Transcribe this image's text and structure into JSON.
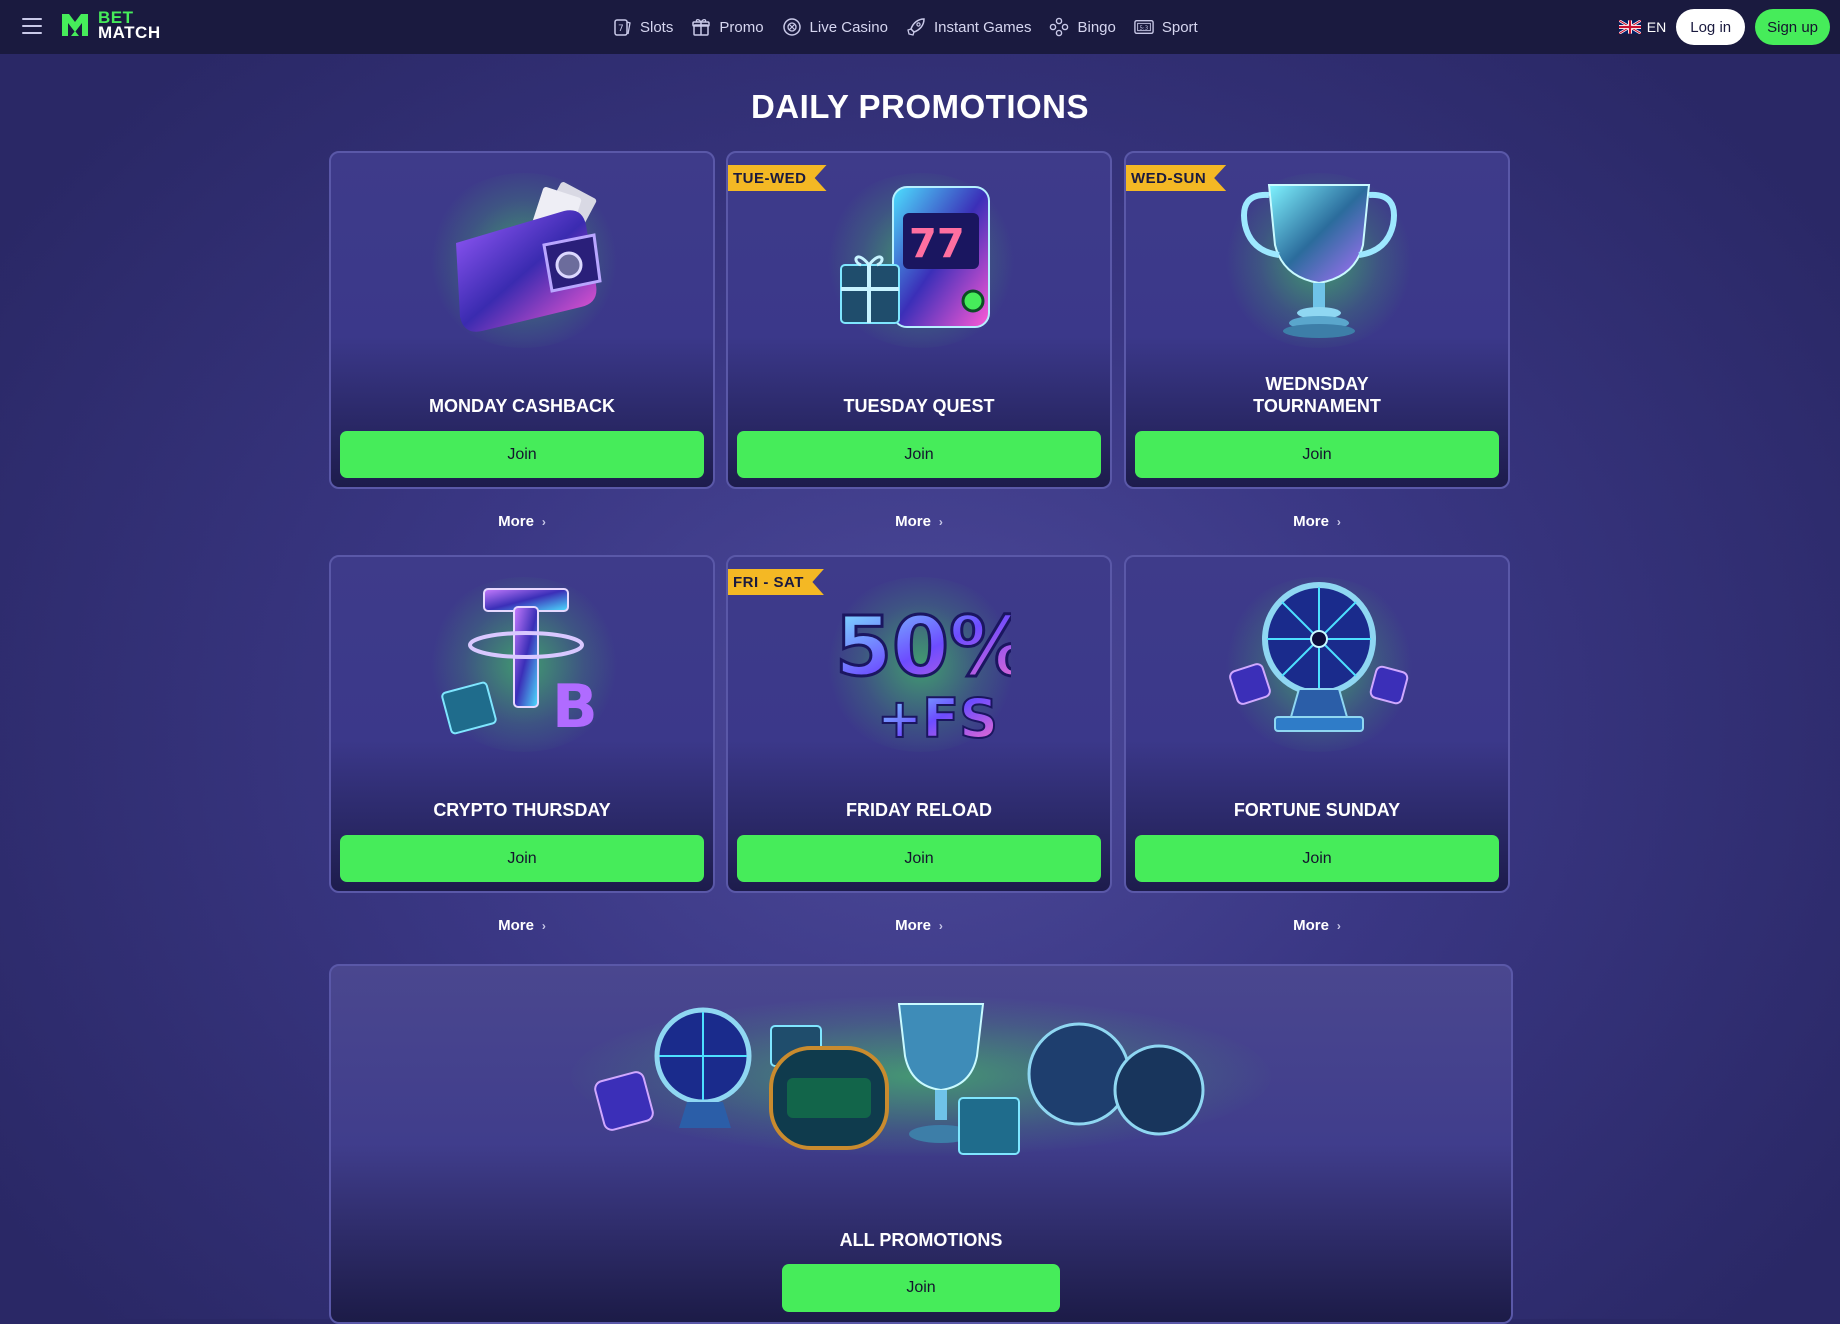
{
  "header": {
    "logo_top": "BET",
    "logo_bottom": "MATCH",
    "nav": [
      {
        "label": "Slots",
        "icon": "slot-card-icon"
      },
      {
        "label": "Promo",
        "icon": "gift-icon"
      },
      {
        "label": "Live Casino",
        "icon": "casino-chip-icon"
      },
      {
        "label": "Instant Games",
        "icon": "rocket-icon"
      },
      {
        "label": "Bingo",
        "icon": "bingo-balls-icon"
      },
      {
        "label": "Sport",
        "icon": "scoreboard-icon"
      }
    ],
    "language": "EN",
    "login_label": "Log in",
    "signup_label": "Sign up"
  },
  "page": {
    "title": "DAILY PROMOTIONS"
  },
  "promotions": [
    {
      "title": "MONDAY CASHBACK",
      "badge": "",
      "art": "wallet",
      "join_label": "Join",
      "more_label": "More"
    },
    {
      "title": "TUESDAY QUEST",
      "badge": "TUE-WED",
      "art": "slot-machine",
      "join_label": "Join",
      "more_label": "More"
    },
    {
      "title": "WEDNSDAY TOURNAMENT",
      "badge": "WED-SUN",
      "art": "trophy",
      "join_label": "Join",
      "more_label": "More"
    },
    {
      "title": "CRYPTO THURSDAY",
      "badge": "",
      "art": "crypto",
      "join_label": "Join",
      "more_label": "More"
    },
    {
      "title": "FRIDAY RELOAD",
      "badge": "FRI - SAT",
      "art": "50-percent-fs",
      "join_label": "Join",
      "more_label": "More"
    },
    {
      "title": "FORTUNE SUNDAY",
      "badge": "",
      "art": "fortune-wheel",
      "join_label": "Join",
      "more_label": "More"
    }
  ],
  "all_promotions": {
    "title": "ALL PROMOTIONS",
    "join_label": "Join"
  },
  "colors": {
    "accent_green": "#46ec5a",
    "badge_yellow": "#f4b824",
    "topbar": "#1a1a3f",
    "background": "#3a3784"
  }
}
